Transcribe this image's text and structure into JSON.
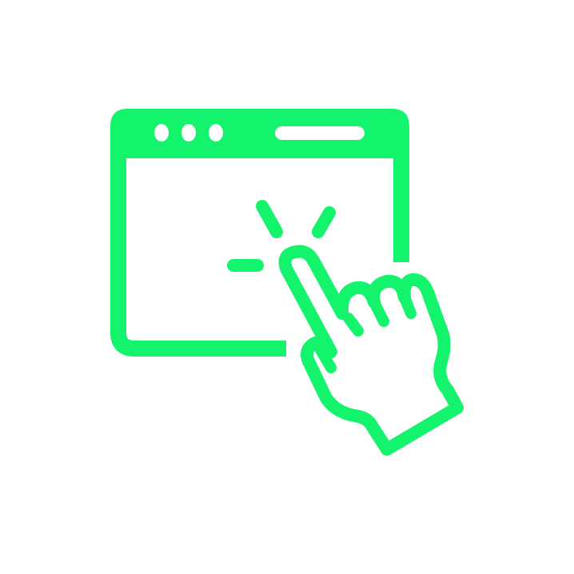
{
  "icon": {
    "name": "browser-click-icon",
    "color": "#13F46C",
    "background": "#FFFFFF"
  }
}
